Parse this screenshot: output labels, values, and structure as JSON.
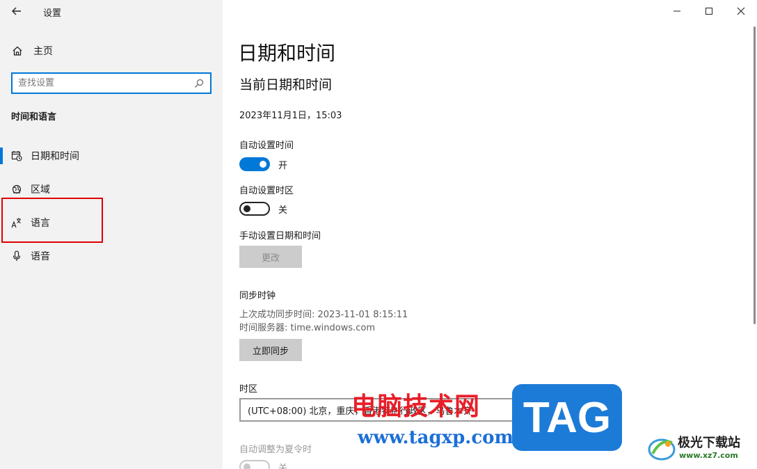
{
  "window": {
    "title": "设置",
    "controls": {
      "minimize": "minimize",
      "maximize": "maximize",
      "close": "close"
    }
  },
  "sidebar": {
    "home_label": "主页",
    "search_placeholder": "查找设置",
    "section_header": "时间和语言",
    "items": [
      {
        "label": "日期和时间",
        "icon": "calendar-clock-icon",
        "selected": true
      },
      {
        "label": "区域",
        "icon": "globe-icon",
        "selected": false
      },
      {
        "label": "语言",
        "icon": "language-icon",
        "selected": false
      },
      {
        "label": "语音",
        "icon": "microphone-icon",
        "selected": false
      }
    ]
  },
  "main": {
    "page_title": "日期和时间",
    "current_section_title": "当前日期和时间",
    "current_datetime": "2023年11月1日，15:03",
    "auto_time": {
      "label": "自动设置时间",
      "state": "开",
      "on": true
    },
    "auto_timezone": {
      "label": "自动设置时区",
      "state": "关",
      "on": false
    },
    "manual": {
      "label": "手动设置日期和时间",
      "button": "更改"
    },
    "sync": {
      "title": "同步时钟",
      "last_sync": "上次成功同步时间: 2023-11-01 8:15:11",
      "server": "时间服务器: time.windows.com",
      "button": "立即同步"
    },
    "timezone": {
      "label": "时区",
      "value": "(UTC+08:00) 北京，重庆，香港特别行政区，乌鲁木齐"
    },
    "dst": {
      "label": "自动调整为夏令时",
      "state": "关",
      "on": false
    }
  },
  "watermarks": {
    "site_cn": "电脑技术网",
    "site_url": "www.tagxp.com",
    "tag": "TAG",
    "logo_cn": "极光下载站",
    "logo_url": "www.xz7.com"
  },
  "colors": {
    "accent": "#0078d7",
    "highlight": "#e00000",
    "sidebar_bg": "#f2f2f2"
  }
}
